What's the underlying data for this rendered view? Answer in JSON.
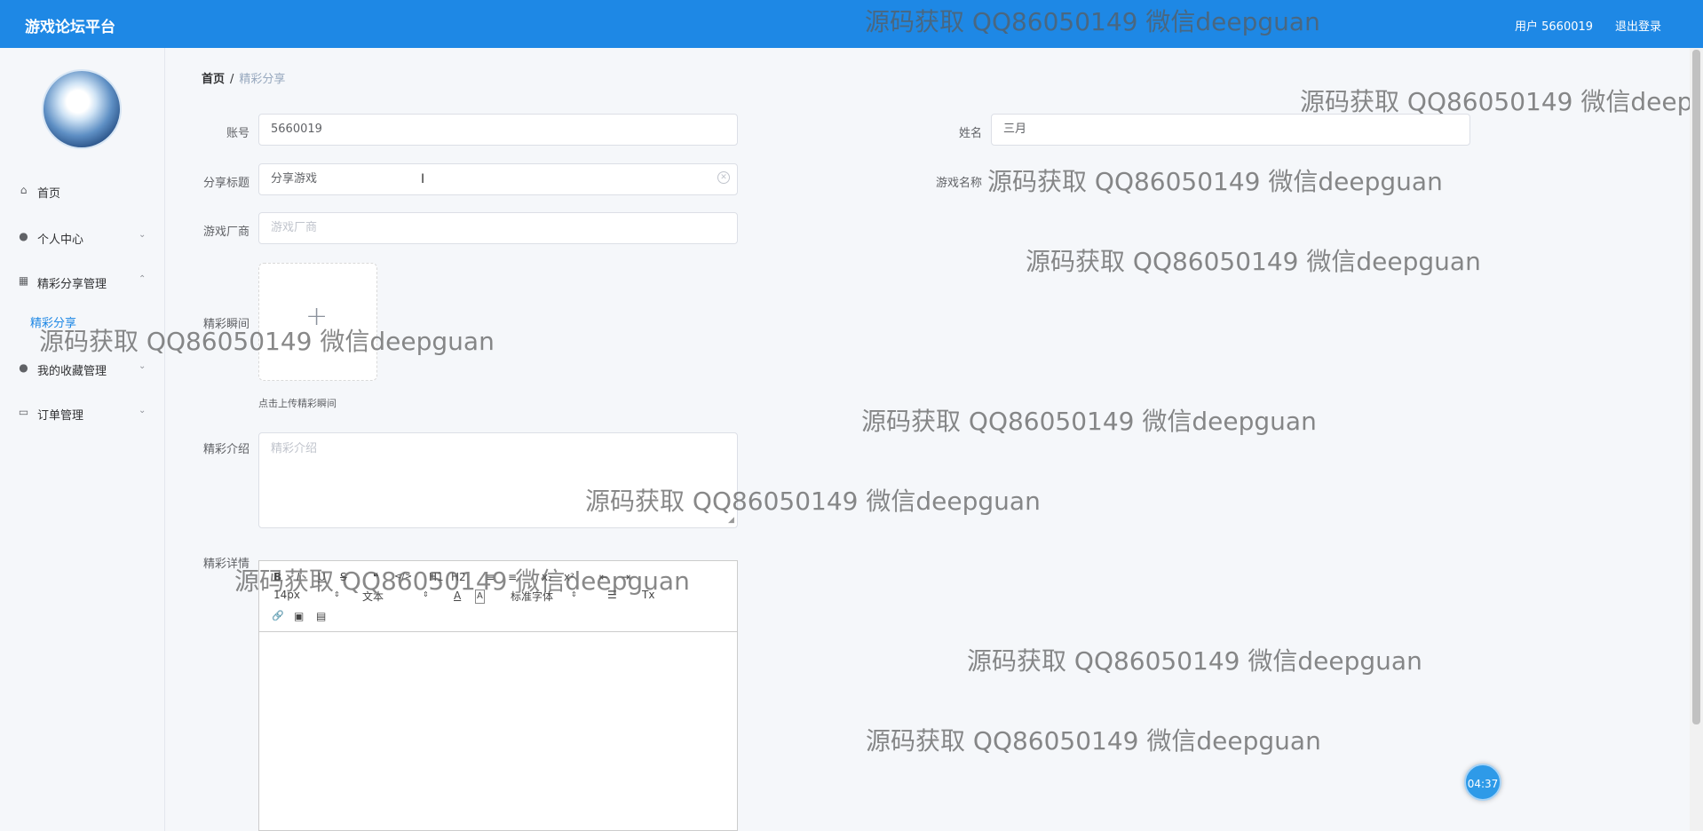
{
  "header": {
    "app_title": "游戏论坛平台",
    "user_label": "用户 5660019",
    "logout_label": "退出登录"
  },
  "sidebar": {
    "items": [
      {
        "label": "首页",
        "icon": "home-icon"
      },
      {
        "label": "个人中心",
        "icon": "user-icon"
      },
      {
        "label": "精彩分享管理",
        "icon": "grid-icon"
      },
      {
        "label": "我的收藏管理",
        "icon": "user-icon"
      },
      {
        "label": "订单管理",
        "icon": "order-icon"
      }
    ],
    "sub_item": "精彩分享"
  },
  "breadcrumb": {
    "home": "首页",
    "separator": "/",
    "current": "精彩分享"
  },
  "form": {
    "account_label": "账号",
    "account_value": "5660019",
    "name_label": "姓名",
    "name_value": "三月",
    "title_label": "分享标题",
    "title_value": "分享游戏",
    "game_name_label": "游戏名称",
    "vendor_label": "游戏厂商",
    "vendor_placeholder": "游戏厂商",
    "moment_label": "精彩瞬间",
    "upload_plus": "+",
    "upload_tip": "点击上传精彩瞬间",
    "intro_label": "精彩介绍",
    "intro_placeholder": "精彩介绍",
    "detail_label": "精彩详情"
  },
  "editor": {
    "row1": [
      "B",
      "I",
      "U",
      "S",
      "❝",
      "</>",
      "H1",
      "H2",
      "≡",
      "≡",
      "x₂",
      "x²",
      "⇤",
      "⇥"
    ],
    "font_size": "14px",
    "block_type": "文本",
    "font_family": "标准字体",
    "row3": [
      "🔗",
      "▣",
      "▤"
    ]
  },
  "timer": "04:37",
  "watermarks": [
    "源码获取 QQ86050149 微信deepguan",
    "源码获取 QQ86050149 微信deepguan",
    "源码获取 QQ86050149 微信deepguan",
    "源码获取 QQ86050149 微信deepguan",
    "源码获取 QQ86050149 微信deepguan",
    "源码获取 QQ86050149 微信deepguan",
    "源码获取 QQ86050149 微信deepguan",
    "源码获取 QQ86050149 微信deepguan",
    "源码获取 QQ86050149 微信deepguan",
    "源码获取 QQ86050149 微信deepguan"
  ],
  "colors": {
    "header_bg": "#1e88e5",
    "active_link": "#1e88e5"
  }
}
